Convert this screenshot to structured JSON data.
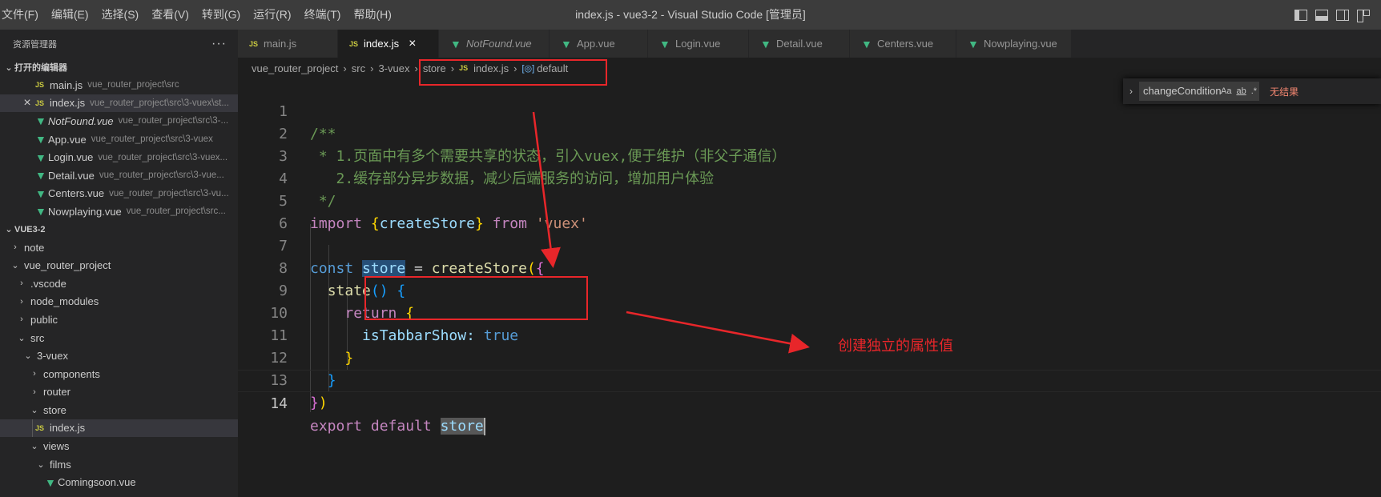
{
  "window": {
    "title": "index.js - vue3-2 - Visual Studio Code [管理员]",
    "menu": [
      "文件(F)",
      "编辑(E)",
      "选择(S)",
      "查看(V)",
      "转到(G)",
      "运行(R)",
      "终端(T)",
      "帮助(H)"
    ]
  },
  "sidebar": {
    "header": "资源管理器",
    "more": "···",
    "open_editors_title": "打开的编辑器",
    "open_editors": [
      {
        "name": "main.js",
        "desc": "vue_router_project\\src"
      },
      {
        "name": "index.js",
        "desc": "vue_router_project\\src\\3-vuex\\st..."
      },
      {
        "name": "NotFound.vue",
        "desc": "vue_router_project\\src\\3-..."
      },
      {
        "name": "App.vue",
        "desc": "vue_router_project\\src\\3-vuex"
      },
      {
        "name": "Login.vue",
        "desc": "vue_router_project\\src\\3-vuex..."
      },
      {
        "name": "Detail.vue",
        "desc": "vue_router_project\\src\\3-vue..."
      },
      {
        "name": "Centers.vue",
        "desc": "vue_router_project\\src\\3-vu..."
      },
      {
        "name": "Nowplaying.vue",
        "desc": "vue_router_project\\src..."
      }
    ],
    "workspace_title": "VUE3-2",
    "tree": [
      "note",
      "vue_router_project",
      ".vscode",
      "node_modules",
      "public",
      "src",
      "3-vuex",
      "components",
      "router",
      "store",
      "index.js",
      "views",
      "films",
      "Comingsoon.vue"
    ]
  },
  "tabs": [
    "main.js",
    "index.js",
    "NotFound.vue",
    "App.vue",
    "Login.vue",
    "Detail.vue",
    "Centers.vue",
    "Nowplaying.vue"
  ],
  "breadcrumb": [
    "vue_router_project",
    "src",
    "3-vuex",
    "store",
    "index.js",
    "default"
  ],
  "find": {
    "value": "changeCondition",
    "opt_case": "Aa",
    "opt_word": "ab",
    "opt_regex": ".*",
    "result": "无结果"
  },
  "code": {
    "line_numbers": [
      "1",
      "2",
      "3",
      "4",
      "5",
      "6",
      "7",
      "8",
      "9",
      "10",
      "11",
      "12",
      "13",
      "14"
    ],
    "l1": "/**",
    "l2": " * 1.页面中有多个需要共享的状态，引入vuex,便于维护（非父子通信）",
    "l3": "   2.缓存部分异步数据，减少后端服务的访问，增加用户体验",
    "l4": " */",
    "import_kw": "import",
    "import_name": "createStore",
    "from_kw": "from",
    "module": "'vuex'",
    "const_kw": "const",
    "store_var": "store",
    "create_call": "createStore",
    "state_fn": "state",
    "return_kw": "return",
    "prop": "isTabbarShow",
    "prop_val": "true",
    "export_kw": "export",
    "default_kw": "default",
    "store_ref": "store"
  },
  "annotation": {
    "text": "创建独立的属性值",
    "color": "#e8262a"
  }
}
